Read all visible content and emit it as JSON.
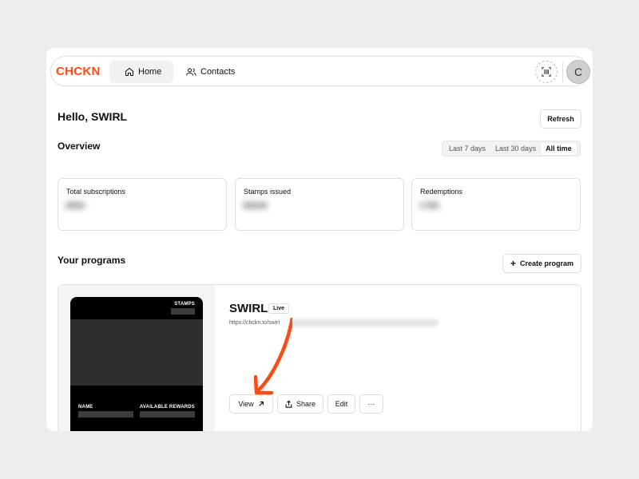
{
  "app": {
    "logo": "CHCKN",
    "brand_color": "#ff4a12"
  },
  "nav": {
    "home_label": "Home",
    "contacts_label": "Contacts",
    "avatar_initial": "C"
  },
  "header": {
    "greeting": "Hello, SWIRL",
    "refresh_label": "Refresh"
  },
  "overview": {
    "title": "Overview",
    "ranges": [
      "Last 7 days",
      "Last 30 days",
      "All time"
    ],
    "active_range": "All time"
  },
  "stats": [
    {
      "label": "Total subscriptions",
      "value": "0852"
    },
    {
      "label": "Stamps issued",
      "value": "00540"
    },
    {
      "label": "Redemptions",
      "value": "1790"
    }
  ],
  "programs": {
    "title": "Your programs",
    "create_label": "Create program",
    "items": [
      {
        "name": "SWIRL",
        "status": "Live",
        "url": "https://chckn.to/swirl",
        "card": {
          "stamps_label": "STAMPS",
          "name_label": "NAME",
          "rewards_label": "AVAILABLE REWARDS"
        },
        "actions": {
          "view": "View",
          "share": "Share",
          "edit": "Edit",
          "more": "···"
        }
      }
    ]
  },
  "annotation": {
    "arrow_color": "#ff4a12"
  }
}
